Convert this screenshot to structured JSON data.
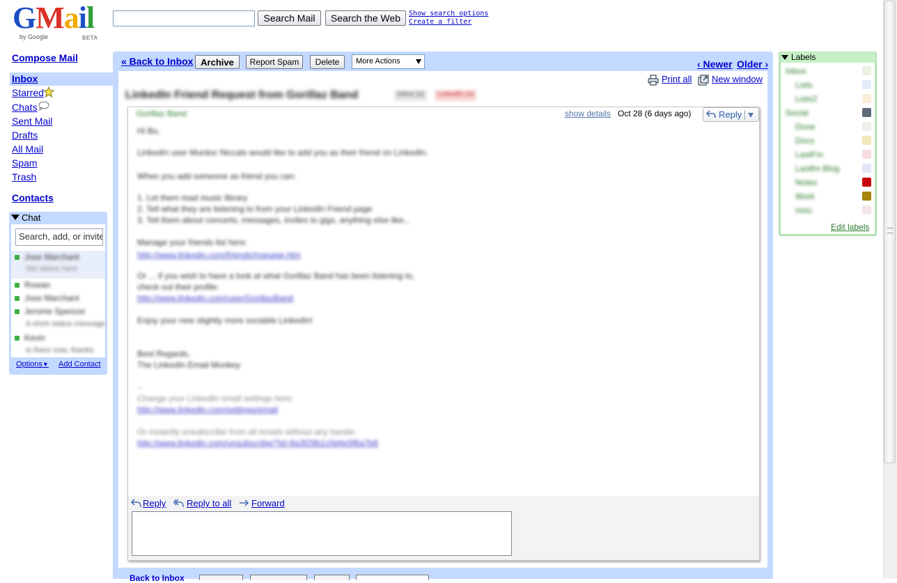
{
  "logo": {
    "word": "Gmail",
    "by": "by Google",
    "beta": "BETA"
  },
  "search": {
    "input_value": "",
    "search_mail_label": "Search Mail",
    "search_web_label": "Search the Web",
    "show_options_label": "Show search options",
    "create_filter_label": "Create a filter"
  },
  "nav": {
    "compose": "Compose Mail",
    "inbox": "Inbox",
    "starred": "Starred",
    "chats": "Chats",
    "sent": "Sent Mail",
    "drafts": "Drafts",
    "all_mail": "All Mail",
    "spam": "Spam",
    "trash": "Trash",
    "contacts": "Contacts"
  },
  "chat": {
    "title": "Chat",
    "search_placeholder": "Search, add, or invite",
    "self_name": "Jose Marchant",
    "self_status": "Set status here",
    "contacts": [
      {
        "name": "Rowan",
        "status": ""
      },
      {
        "name": "Jose Marchant",
        "status": ""
      },
      {
        "name": "Jerome Spencer",
        "status": "A short status message"
      },
      {
        "name": "Kevin",
        "status": "is there now, thanks"
      }
    ],
    "options_label": "Options",
    "add_contact_label": "Add Contact"
  },
  "toolbar": {
    "back_label": "« Back to Inbox",
    "archive_label": "Archive",
    "report_spam_label": "Report Spam",
    "delete_label": "Delete",
    "more_actions_label": "More Actions",
    "newer_label": "‹ Newer",
    "older_label": "Older ›"
  },
  "thread": {
    "print_all_label": "Print all",
    "new_window_label": "New window",
    "subject": "LinkedIn Friend Request from Gorillaz Band",
    "tags": [
      "Inbox (x)",
      "LinkedIn (x)"
    ],
    "sender": "Gorillaz Band",
    "show_details_label": "show details",
    "date": "Oct 28 (6 days ago)",
    "reply_label": "Reply",
    "body": [
      "Hi Bo,",
      "LinkedIn user Murdoc Niccals would like to add you as their friend on LinkedIn.",
      "When you add someone as friend you can:",
      "1. Let them read music library",
      "2. Tell what they are listening to from your LinkedIn Friend page",
      "3. Tell them about concerts, messages, invites to gigs, anything else like...",
      "Manage your friends list here:",
      "http://www.linkedin.com/friends/manage.htm",
      "Or ... if you wish to have a look at what Gorillaz Band has been listening to,",
      "check out their profile:",
      "http://www.linkedin.com/user/GorillazBand",
      "Enjoy your new slightly more sociable LinkedIn!",
      "Best Regards,",
      "The LinkedIn Email Monkey",
      "--",
      "Change your LinkedIn email settings here:",
      "http://www.linkedin.com/settings/email",
      "Or instantly unsubscribe from all emails without any hassle:",
      "http://www.linkedin.com/unsubscribe/?id=8a3f29b1c0d4e5f6a7b8"
    ],
    "footer_reply": "Reply",
    "footer_reply_all": "Reply to all",
    "footer_forward": "Forward"
  },
  "bottom": {
    "back_label": "Back to Inbox"
  },
  "labels": {
    "title": "Labels",
    "items": [
      {
        "name": "Inbox",
        "color": "#e9f2e3"
      },
      {
        "name": "Lists",
        "color": "#e3ecfa"
      },
      {
        "name": "Lists2",
        "color": "#fbeed9"
      },
      {
        "name": "Social",
        "color": "#5e6b7b"
      },
      {
        "name": "Done",
        "color": "#eef0ec"
      },
      {
        "name": "Docs",
        "color": "#f2e8bb"
      },
      {
        "name": "LastFm",
        "color": "#f8dede"
      },
      {
        "name": "Lastfm Blog",
        "color": "#e3e6f8"
      },
      {
        "name": "Notes",
        "color": "#c8000b"
      },
      {
        "name": "Work",
        "color": "#a8860b"
      },
      {
        "name": "misc",
        "color": "#f5e6ea"
      }
    ],
    "edit_label": "Edit labels"
  }
}
